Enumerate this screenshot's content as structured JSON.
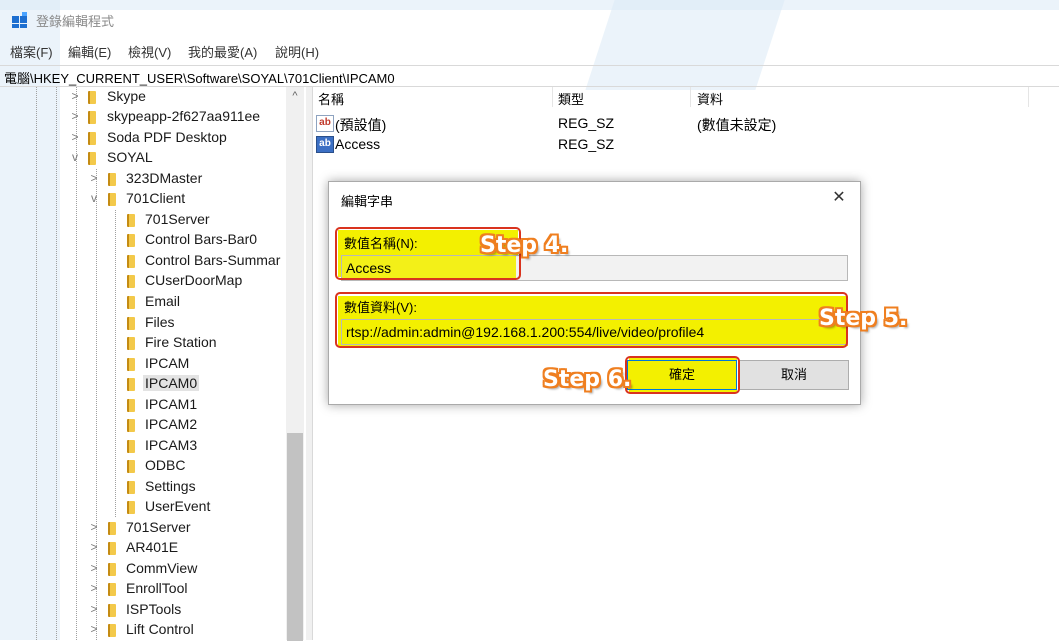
{
  "window": {
    "title": "登錄編輯程式"
  },
  "menu": [
    "檔案(F)",
    "編輯(E)",
    "檢視(V)",
    "我的最愛(A)",
    "說明(H)"
  ],
  "address": "電腦\\HKEY_CURRENT_USER\\Software\\SOYAL\\701Client\\IPCAM0",
  "tree": {
    "items": [
      {
        "label": "Skype",
        "twisty": ">"
      },
      {
        "label": "skypeapp-2f627aa911ee",
        "twisty": ">"
      },
      {
        "label": "Soda PDF Desktop",
        "twisty": ">"
      },
      {
        "label": "SOYAL",
        "twisty": "v"
      },
      {
        "label": "323DMaster",
        "twisty": ">"
      },
      {
        "label": "701Client",
        "twisty": "v"
      },
      {
        "label": "701Server",
        "twisty": ""
      },
      {
        "label": "Control Bars-Bar0",
        "twisty": ""
      },
      {
        "label": "Control Bars-Summar",
        "twisty": ""
      },
      {
        "label": "CUserDoorMap",
        "twisty": ""
      },
      {
        "label": "Email",
        "twisty": ""
      },
      {
        "label": "Files",
        "twisty": ""
      },
      {
        "label": "Fire Station",
        "twisty": ""
      },
      {
        "label": "IPCAM",
        "twisty": ""
      },
      {
        "label": "IPCAM0",
        "twisty": "",
        "selected": true
      },
      {
        "label": "IPCAM1",
        "twisty": ""
      },
      {
        "label": "IPCAM2",
        "twisty": ""
      },
      {
        "label": "IPCAM3",
        "twisty": ""
      },
      {
        "label": "ODBC",
        "twisty": ""
      },
      {
        "label": "Settings",
        "twisty": ""
      },
      {
        "label": "UserEvent",
        "twisty": ""
      },
      {
        "label": "701Server",
        "twisty": ">"
      },
      {
        "label": "AR401E",
        "twisty": ">"
      },
      {
        "label": "CommView",
        "twisty": ">"
      },
      {
        "label": "EnrollTool",
        "twisty": ">"
      },
      {
        "label": "ISPTools",
        "twisty": ">"
      },
      {
        "label": "Lift Control",
        "twisty": ">"
      }
    ],
    "scroll_up": "^"
  },
  "list": {
    "columns": [
      "名稱",
      "類型",
      "資料"
    ],
    "rows": [
      {
        "icon": "ab",
        "name": "(預設值)",
        "type": "REG_SZ",
        "data": "(數值未設定)"
      },
      {
        "icon": "ab",
        "name": "Access",
        "type": "REG_SZ",
        "data": ""
      }
    ]
  },
  "dialog": {
    "title": "編輯字串",
    "close": "✕",
    "name_label": "數值名稱(N):",
    "name_value": "Access",
    "data_label": "數值資料(V):",
    "data_value": "rtsp://admin:admin@192.168.1.200:554/live/video/profile4",
    "ok_label": "確定",
    "cancel_label": "取消"
  },
  "annotations": {
    "step4": "Step 4.",
    "step5": "Step 5.",
    "step6": "Step 6."
  },
  "colors": {
    "highlight": "#f3f000",
    "callout_border": "#d9331e",
    "step_outline": "#ef7f20"
  }
}
